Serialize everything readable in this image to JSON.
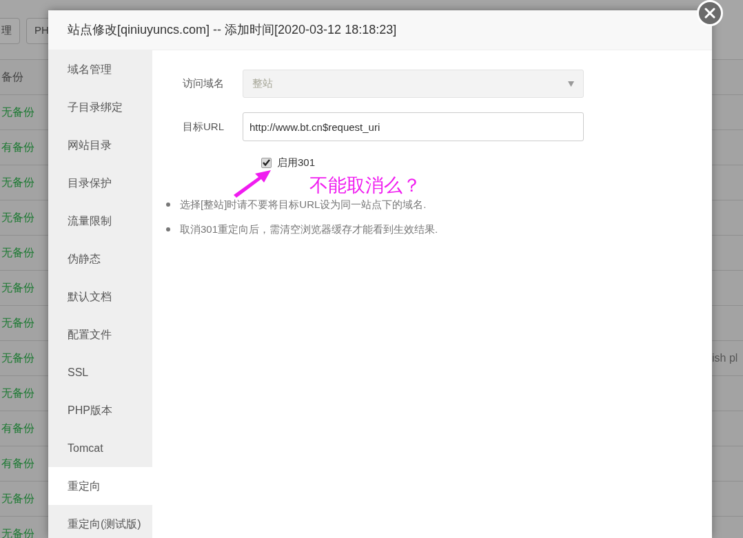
{
  "background": {
    "toolbar_buttons": [
      "理",
      "PH"
    ],
    "table": {
      "header": "备份",
      "rows": [
        {
          "backup": "无备份"
        },
        {
          "backup": "有备份"
        },
        {
          "backup": "无备份"
        },
        {
          "backup": "无备份"
        },
        {
          "backup": "无备份"
        },
        {
          "backup": "无备份"
        },
        {
          "backup": "无备份"
        },
        {
          "backup": "无备份",
          "column_2": "ish pl"
        },
        {
          "backup": "无备份"
        },
        {
          "backup": "有备份"
        },
        {
          "backup": "有备份"
        },
        {
          "backup": "无备份"
        },
        {
          "backup": "无备份"
        }
      ]
    }
  },
  "dialog": {
    "title": "站点修改[qiniuyuncs.com] -- 添加时间[2020-03-12 18:18:23]",
    "sidebar": {
      "items": [
        {
          "label": "域名管理",
          "selected": false
        },
        {
          "label": "子目录绑定",
          "selected": false
        },
        {
          "label": "网站目录",
          "selected": false
        },
        {
          "label": "目录保护",
          "selected": false
        },
        {
          "label": "流量限制",
          "selected": false
        },
        {
          "label": "伪静态",
          "selected": false
        },
        {
          "label": "默认文档",
          "selected": false
        },
        {
          "label": "配置文件",
          "selected": false
        },
        {
          "label": "SSL",
          "selected": false
        },
        {
          "label": "PHP版本",
          "selected": false
        },
        {
          "label": "Tomcat",
          "selected": false
        },
        {
          "label": "重定向",
          "selected": true
        },
        {
          "label": "重定向(测试版)",
          "selected": false
        }
      ]
    },
    "form": {
      "domain": {
        "label": "访问域名",
        "value": "整站",
        "disabled": true
      },
      "target_url": {
        "label": "目标URL",
        "value": "http://www.bt.cn$request_uri"
      },
      "enable_301": {
        "label": "启用301",
        "checked": true
      }
    },
    "notes": [
      "选择[整站]时请不要将目标URL设为同一站点下的域名.",
      "取消301重定向后，需清空浏览器缓存才能看到生效结果."
    ]
  },
  "annotation": {
    "text": "不能取消么？"
  }
}
